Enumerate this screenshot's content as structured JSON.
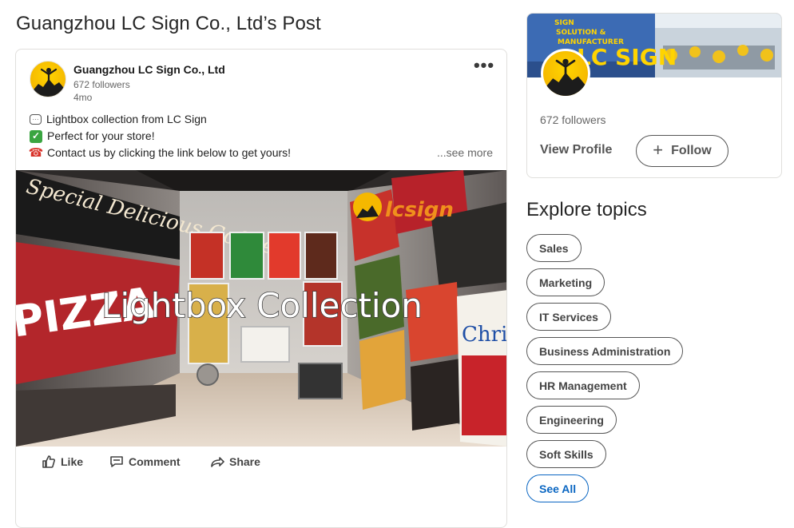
{
  "page": {
    "title": "Guangzhou LC Sign Co., Ltd’s Post"
  },
  "post": {
    "company_name": "Guangzhou LC Sign Co., Ltd",
    "followers": "672 followers",
    "time": "4mo",
    "more_icon": "•••",
    "lines": [
      {
        "icon": "speech-balloon-icon",
        "text": "Lightbox collection from LC Sign"
      },
      {
        "icon": "check-mark-icon",
        "text": "Perfect for your store!"
      },
      {
        "icon": "telephone-icon",
        "text": "Contact us by clicking the link below to get yours!"
      }
    ],
    "see_more": "...see more",
    "image": {
      "overlay_text": "Lightbox Collection",
      "signs": {
        "coffee": "Special Delicious Coffee",
        "pizza": "PIZZA",
        "logo": "lcsign",
        "christmas": "Christ"
      }
    },
    "actions": {
      "like": "Like",
      "comment": "Comment",
      "share": "Share"
    }
  },
  "company_card": {
    "cover_text": "SIGN SOLUTION & MANUFACTURER LC SIGN",
    "followers": "672 followers",
    "view_profile": "View Profile",
    "follow": "Follow",
    "follow_icon": "+"
  },
  "explore": {
    "title": "Explore topics",
    "topics": [
      "Sales",
      "Marketing",
      "IT Services",
      "Business Administration",
      "HR Management",
      "Engineering",
      "Soft Skills"
    ],
    "see_all": "See All"
  },
  "colors": {
    "accent": "#0a66c2",
    "brand_yellow": "#f5b800",
    "text": "#1a1a1a",
    "muted": "#666666"
  }
}
